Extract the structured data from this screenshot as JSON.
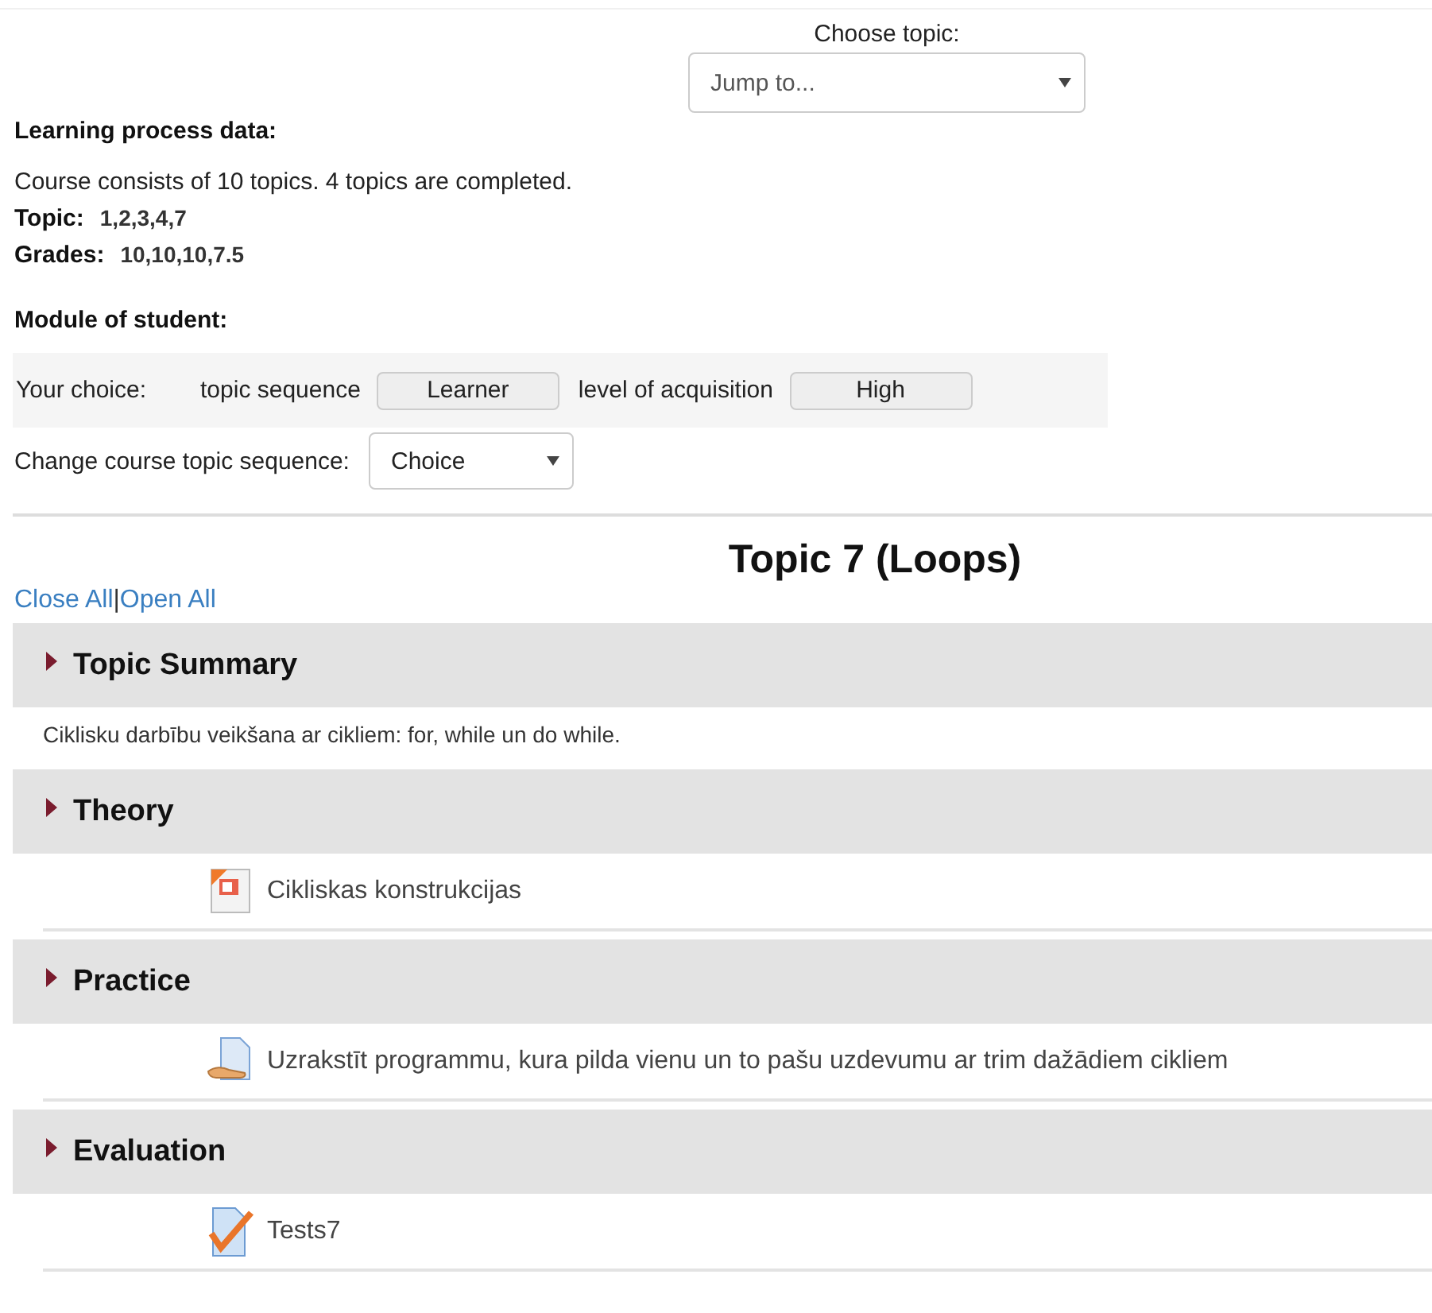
{
  "jump": {
    "label": "Choose topic:",
    "placeholder": "Jump to..."
  },
  "learning": {
    "heading": "Learning process data:",
    "summary": "Course consists of 10 topics. 4 topics are completed.",
    "topic_label": "Topic:",
    "topic_value": "1,2,3,4,7",
    "grades_label": "Grades:",
    "grades_value": "10,10,10,7.5"
  },
  "module": {
    "heading": "Module of student:",
    "choice_label": "Your choice:",
    "sequence_label": "topic sequence",
    "sequence_value": "Learner",
    "level_label": "level of acquisition",
    "level_value": "High",
    "change_label": "Change course topic sequence:",
    "change_value": "Choice"
  },
  "title": "Topic 7 (Loops)",
  "links": {
    "items": [
      "Close All",
      "Open All"
    ],
    "separator": "|"
  },
  "sections": [
    {
      "title": "Topic Summary",
      "kind": "summary",
      "text": "Ciklisku darbību veikšana ar cikliem: for, while un do while."
    },
    {
      "title": "Theory",
      "kind": "activities",
      "items": [
        {
          "kind": "slides",
          "label": "Cikliskas konstrukcijas"
        }
      ]
    },
    {
      "title": "Practice",
      "kind": "activities",
      "items": [
        {
          "kind": "assignment",
          "label": "Uzrakstīt programmu, kura pilda vienu un to pašu uzdevumu ar trim dažādiem cikliem"
        }
      ]
    },
    {
      "title": "Evaluation",
      "kind": "activities",
      "items": [
        {
          "kind": "quiz",
          "label": "Tests7"
        }
      ]
    }
  ]
}
